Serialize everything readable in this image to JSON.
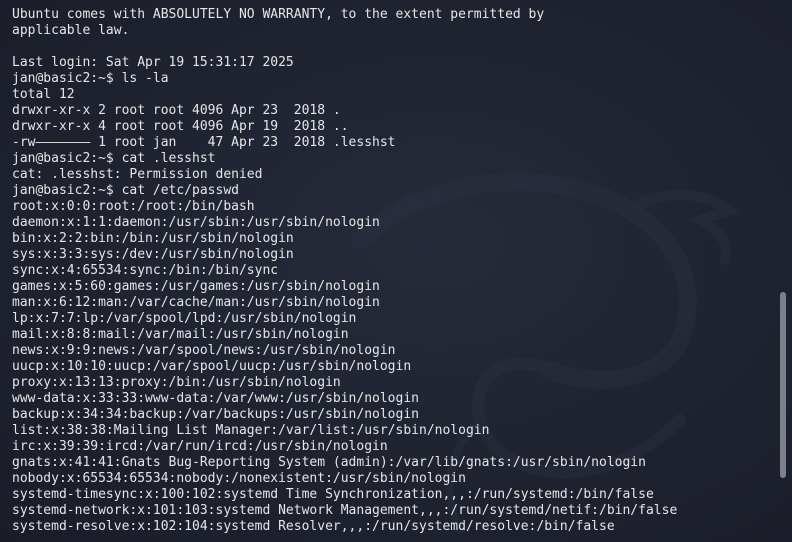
{
  "terminal": {
    "lines": [
      "Ubuntu comes with ABSOLUTELY NO WARRANTY, to the extent permitted by",
      "applicable law.",
      "",
      "Last login: Sat Apr 19 15:31:17 2025",
      "jan@basic2:~$ ls -la",
      "total 12",
      "drwxr-xr-x 2 root root 4096 Apr 23  2018 .",
      "drwxr-xr-x 4 root root 4096 Apr 19  2018 ..",
      "-rw——————— 1 root jan    47 Apr 23  2018 .lesshst",
      "jan@basic2:~$ cat .lesshst",
      "cat: .lesshst: Permission denied",
      "jan@basic2:~$ cat /etc/passwd",
      "root:x:0:0:root:/root:/bin/bash",
      "daemon:x:1:1:daemon:/usr/sbin:/usr/sbin/nologin",
      "bin:x:2:2:bin:/bin:/usr/sbin/nologin",
      "sys:x:3:3:sys:/dev:/usr/sbin/nologin",
      "sync:x:4:65534:sync:/bin:/bin/sync",
      "games:x:5:60:games:/usr/games:/usr/sbin/nologin",
      "man:x:6:12:man:/var/cache/man:/usr/sbin/nologin",
      "lp:x:7:7:lp:/var/spool/lpd:/usr/sbin/nologin",
      "mail:x:8:8:mail:/var/mail:/usr/sbin/nologin",
      "news:x:9:9:news:/var/spool/news:/usr/sbin/nologin",
      "uucp:x:10:10:uucp:/var/spool/uucp:/usr/sbin/nologin",
      "proxy:x:13:13:proxy:/bin:/usr/sbin/nologin",
      "www-data:x:33:33:www-data:/var/www:/usr/sbin/nologin",
      "backup:x:34:34:backup:/var/backups:/usr/sbin/nologin",
      "list:x:38:38:Mailing List Manager:/var/list:/usr/sbin/nologin",
      "irc:x:39:39:ircd:/var/run/ircd:/usr/sbin/nologin",
      "gnats:x:41:41:Gnats Bug-Reporting System (admin):/var/lib/gnats:/usr/sbin/nologin",
      "nobody:x:65534:65534:nobody:/nonexistent:/usr/sbin/nologin",
      "systemd-timesync:x:100:102:systemd Time Synchronization,,,:/run/systemd:/bin/false",
      "systemd-network:x:101:103:systemd Network Management,,,:/run/systemd/netif:/bin/false",
      "systemd-resolve:x:102:104:systemd Resolver,,,:/run/systemd/resolve:/bin/false"
    ]
  },
  "colors": {
    "background": "#1f2330",
    "text": "#e6e6e6",
    "scrollbar": "#7c8089"
  },
  "icons": {
    "watermark": "kali-dragon-icon"
  }
}
